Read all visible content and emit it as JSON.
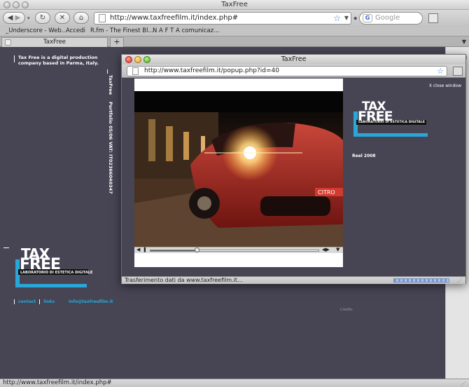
{
  "window": {
    "title": "TaxFree",
    "url": "http://www.taxfreefilm.it/index.php#",
    "search_placeholder": "Google",
    "status_text": "http://www.taxfreefilm.it/index.php#"
  },
  "bookmarks": [
    "_Underscore - Web...",
    "Accedi",
    "R.fm - The Finest Bl...",
    "N A F T A comunicaz..."
  ],
  "tabs": [
    {
      "label": "TaxFree"
    }
  ],
  "page": {
    "tagline": "Tax Free is a digital production company based in Parma, Italy.",
    "vertical_items": [
      "TaxFree",
      "Portfolio 05/06",
      "VAT: IT02366040347"
    ],
    "logo": {
      "tax": "TAX",
      "free": "FREE",
      "subtitle": "LABORATORIO DI ESTETICA DIGITALE"
    },
    "footer_links": [
      "contact",
      "links"
    ],
    "email": "info@taxfreefilm.it",
    "credits": "Credits"
  },
  "popup": {
    "title": "TaxFree",
    "url": "http://www.taxfreefilm.it/popup.php?id=40",
    "close_label": "X close window",
    "reel_label": "Reel 2008",
    "status_text": "Trasferimento dati da www.taxfreefilm.it...",
    "plate_text": "CITRO",
    "video_progress": 0.28
  },
  "colors": {
    "page_bg": "#474453",
    "accent": "#29a7d8"
  },
  "icons": [
    "back-icon",
    "forward-icon",
    "reload-icon",
    "stop-icon",
    "home-icon",
    "bookmark-star-icon",
    "google-icon",
    "feed-icon"
  ]
}
